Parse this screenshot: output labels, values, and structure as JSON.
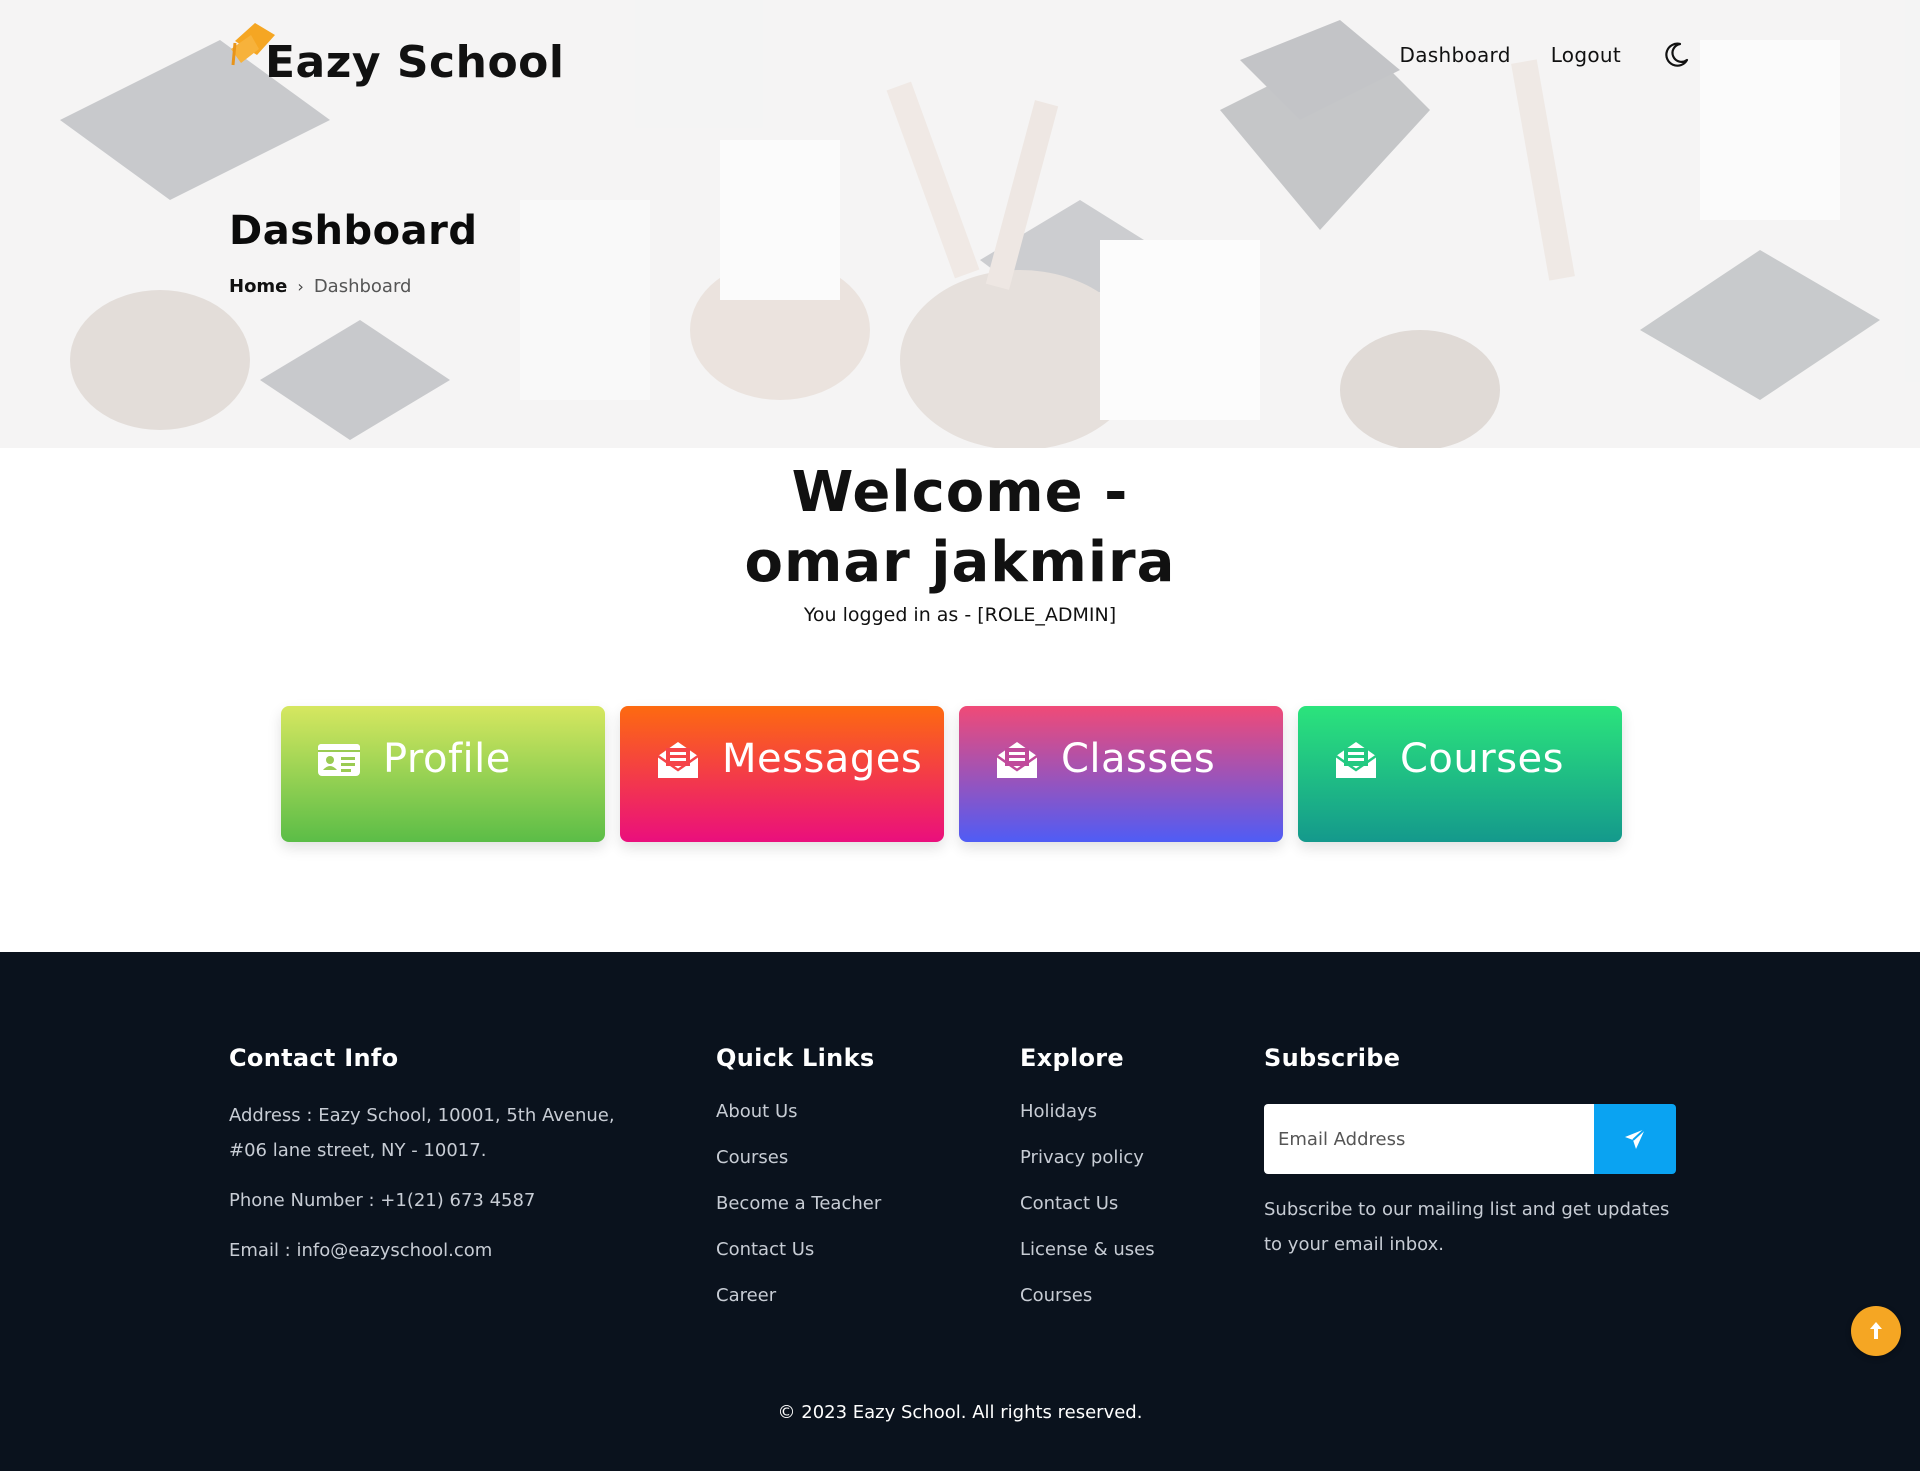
{
  "brand": {
    "name": "Eazy School",
    "accent": "#f5a623"
  },
  "nav": {
    "dashboard": "Dashboard",
    "logout": "Logout",
    "theme_icon": "moon-icon"
  },
  "page": {
    "title": "Dashboard",
    "breadcrumb": {
      "home": "Home",
      "current": "Dashboard"
    }
  },
  "welcome": {
    "heading": "Welcome - omar jakmira",
    "role_text": "You logged in as - [ROLE_ADMIN]"
  },
  "cards": [
    {
      "label": "Profile",
      "icon": "id-card-icon"
    },
    {
      "label": "Messages",
      "icon": "envelope-open-icon"
    },
    {
      "label": "Classes",
      "icon": "envelope-open-icon"
    },
    {
      "label": "Courses",
      "icon": "envelope-open-icon"
    }
  ],
  "footer": {
    "contact": {
      "title": "Contact Info",
      "address": "Address : Eazy School, 10001, 5th Avenue, #06 lane street, NY - 10017.",
      "phone": "Phone Number : +1(21) 673 4587",
      "email": "Email : info@eazyschool.com"
    },
    "quick_links": {
      "title": "Quick Links",
      "items": [
        "About Us",
        "Courses",
        "Become a Teacher",
        "Contact Us",
        "Career"
      ]
    },
    "explore": {
      "title": "Explore",
      "items": [
        "Holidays",
        "Privacy policy",
        "Contact Us",
        "License & uses",
        "Courses"
      ]
    },
    "subscribe": {
      "title": "Subscribe",
      "placeholder": "Email Address",
      "text": "Subscribe to our mailing list and get updates to your email inbox."
    },
    "copyright": "© 2023 Eazy School. All rights reserved."
  }
}
